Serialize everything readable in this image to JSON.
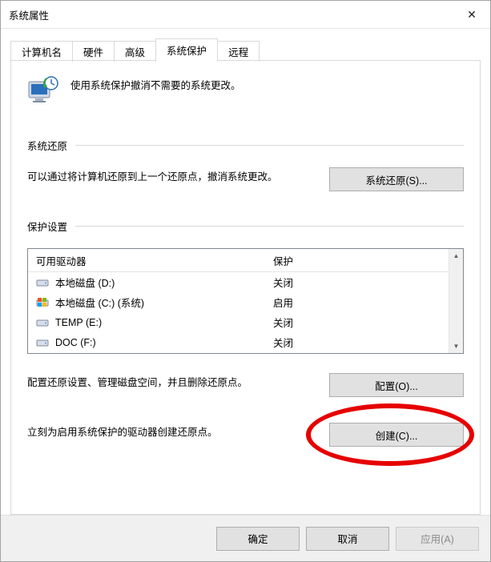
{
  "window": {
    "title": "系统属性",
    "close_glyph": "✕"
  },
  "tabs": {
    "items": [
      {
        "label": "计算机名"
      },
      {
        "label": "硬件"
      },
      {
        "label": "高级"
      },
      {
        "label": "系统保护"
      },
      {
        "label": "远程"
      }
    ],
    "active_index": 3
  },
  "intro": {
    "text": "使用系统保护撤消不需要的系统更改。"
  },
  "restore_section": {
    "title": "系统还原",
    "text": "可以通过将计算机还原到上一个还原点，撤消系统更改。",
    "button": "系统还原(S)..."
  },
  "settings_section": {
    "title": "保护设置",
    "table": {
      "col_drive": "可用驱动器",
      "col_status": "保护",
      "rows": [
        {
          "icon": "hdd",
          "label": "本地磁盘 (D:)",
          "status": "关闭"
        },
        {
          "icon": "winhdd",
          "label": "本地磁盘 (C:) (系统)",
          "status": "启用"
        },
        {
          "icon": "hdd",
          "label": "TEMP (E:)",
          "status": "关闭"
        },
        {
          "icon": "hdd",
          "label": "DOC (F:)",
          "status": "关闭"
        }
      ]
    },
    "config_text": "配置还原设置、管理磁盘空间，并且删除还原点。",
    "config_button": "配置(O)...",
    "create_text": "立刻为启用系统保护的驱动器创建还原点。",
    "create_button": "创建(C)..."
  },
  "dialog_buttons": {
    "ok": "确定",
    "cancel": "取消",
    "apply": "应用(A)"
  }
}
